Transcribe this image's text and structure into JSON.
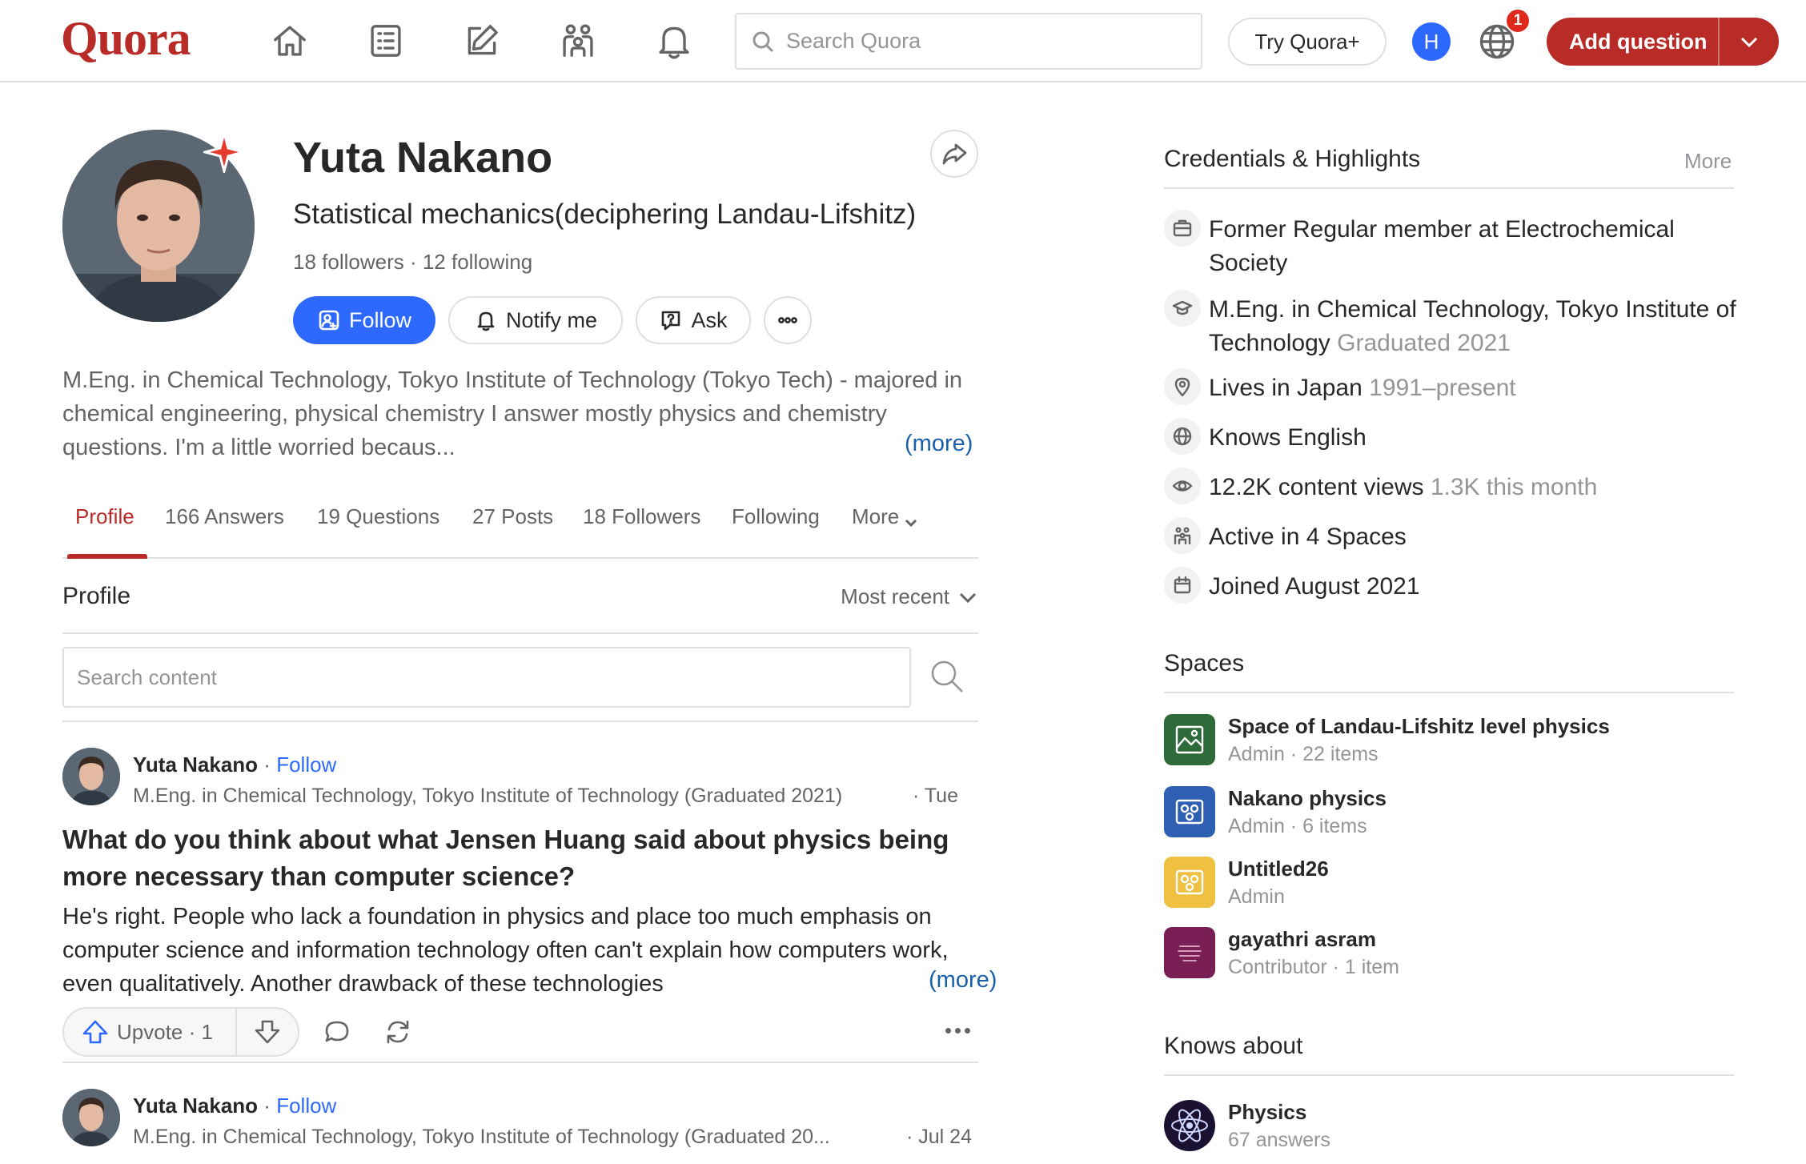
{
  "header": {
    "logo": "Quora",
    "search_placeholder": "Search Quora",
    "try_plus": "Try Quora+",
    "user_initial": "H",
    "notification_count": "1",
    "add_question": "Add question"
  },
  "profile": {
    "name": "Yuta Nakano",
    "tagline": "Statistical mechanics(deciphering Landau-Lifshitz)",
    "follow_counts": "18 followers · 12 following",
    "buttons": {
      "follow": "Follow",
      "notify": "Notify me",
      "ask": "Ask"
    },
    "bio": "M.Eng. in Chemical Technology, Tokyo Institute of Technology (Tokyo Tech) - majored in chemical engineering, physical chemistry I answer mostly physics and chemistry questions. I'm a little worried becaus...",
    "bio_more": "(more)"
  },
  "tabs": [
    {
      "label": "Profile"
    },
    {
      "label": "166 Answers"
    },
    {
      "label": "19 Questions"
    },
    {
      "label": "27 Posts"
    },
    {
      "label": "18 Followers"
    },
    {
      "label": "Following"
    },
    {
      "label": "More"
    }
  ],
  "section": {
    "title": "Profile",
    "sort_label": "Most recent",
    "search_placeholder": "Search content"
  },
  "feed": [
    {
      "author": "Yuta Nakano",
      "follow": "Follow",
      "credential": "M.Eng. in Chemical Technology, Tokyo Institute of Technology (Graduated 2021)",
      "date": "· Tue",
      "title": "What do you think about what Jensen Huang said about physics being more necessary than computer science?",
      "body": "He's right. People who lack a foundation in physics and place too much emphasis on computer science and information technology often can't explain how computers work, even qualitatively. Another drawback of these technologies",
      "more": "(more)",
      "upvote": "Upvote · 1"
    },
    {
      "author": "Yuta Nakano",
      "follow": "Follow",
      "credential": "M.Eng. in Chemical Technology, Tokyo Institute of Technology (Graduated 20...",
      "date": "· Jul 24"
    }
  ],
  "credentials": {
    "title": "Credentials & Highlights",
    "more": "More",
    "items": [
      {
        "icon": "briefcase-icon",
        "text": "Former Regular member at Electrochemical Society",
        "muted": ""
      },
      {
        "icon": "graduation-cap-icon",
        "text": "M.Eng. in Chemical Technology, Tokyo Institute of Technology",
        "muted": "Graduated 2021"
      },
      {
        "icon": "location-pin-icon",
        "text": "Lives in Japan",
        "muted": "1991–present"
      },
      {
        "icon": "globe-icon",
        "text": "Knows English",
        "muted": ""
      },
      {
        "icon": "eye-icon",
        "text": "12.2K content views",
        "muted": "1.3K this month"
      },
      {
        "icon": "spaces-icon",
        "text": "Active in 4 Spaces",
        "muted": ""
      },
      {
        "icon": "calendar-icon",
        "text": "Joined August 2021",
        "muted": ""
      }
    ]
  },
  "spaces": {
    "title": "Spaces",
    "items": [
      {
        "name": "Space of Landau-Lifshitz level physics",
        "meta": "Admin · 22 items",
        "color": "#2f6b3a"
      },
      {
        "name": "Nakano physics",
        "meta": "Admin · 6 items",
        "color": "#2f5fb3"
      },
      {
        "name": "Untitled26",
        "meta": "Admin",
        "color": "#f0c040"
      },
      {
        "name": "gayathri asram",
        "meta": "Contributor · 1 item",
        "color": "#7a1f55"
      }
    ]
  },
  "knows_about": {
    "title": "Knows about",
    "items": [
      {
        "name": "Physics",
        "meta": "67 answers"
      }
    ]
  },
  "colors": {
    "brand": "#b92b27",
    "accent": "#2e69ff",
    "link": "#195faa",
    "border": "#dee0e1",
    "muted": "#939598"
  }
}
